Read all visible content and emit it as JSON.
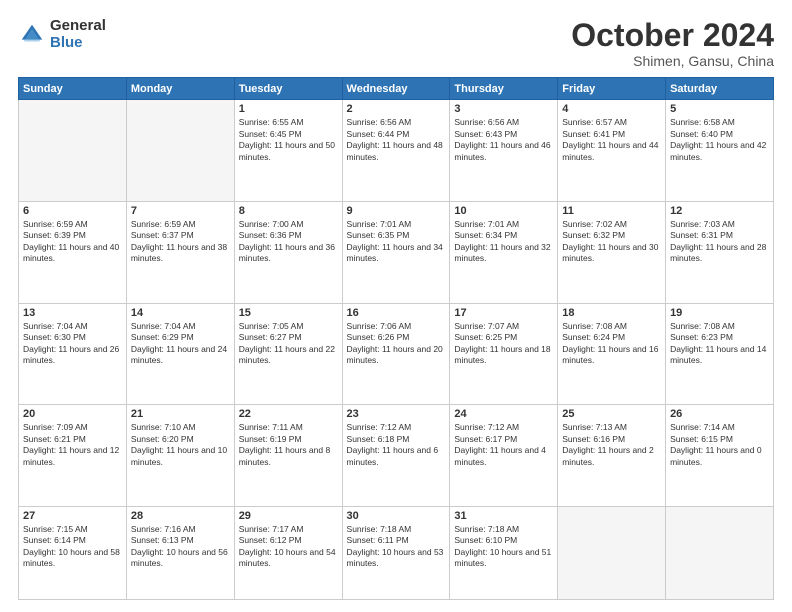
{
  "logo": {
    "general": "General",
    "blue": "Blue"
  },
  "header": {
    "month": "October 2024",
    "location": "Shimen, Gansu, China"
  },
  "weekdays": [
    "Sunday",
    "Monday",
    "Tuesday",
    "Wednesday",
    "Thursday",
    "Friday",
    "Saturday"
  ],
  "weeks": [
    [
      {
        "day": "",
        "sunrise": "",
        "sunset": "",
        "daylight": "",
        "empty": true
      },
      {
        "day": "",
        "sunrise": "",
        "sunset": "",
        "daylight": "",
        "empty": true
      },
      {
        "day": "1",
        "sunrise": "Sunrise: 6:55 AM",
        "sunset": "Sunset: 6:45 PM",
        "daylight": "Daylight: 11 hours and 50 minutes.",
        "empty": false
      },
      {
        "day": "2",
        "sunrise": "Sunrise: 6:56 AM",
        "sunset": "Sunset: 6:44 PM",
        "daylight": "Daylight: 11 hours and 48 minutes.",
        "empty": false
      },
      {
        "day": "3",
        "sunrise": "Sunrise: 6:56 AM",
        "sunset": "Sunset: 6:43 PM",
        "daylight": "Daylight: 11 hours and 46 minutes.",
        "empty": false
      },
      {
        "day": "4",
        "sunrise": "Sunrise: 6:57 AM",
        "sunset": "Sunset: 6:41 PM",
        "daylight": "Daylight: 11 hours and 44 minutes.",
        "empty": false
      },
      {
        "day": "5",
        "sunrise": "Sunrise: 6:58 AM",
        "sunset": "Sunset: 6:40 PM",
        "daylight": "Daylight: 11 hours and 42 minutes.",
        "empty": false
      }
    ],
    [
      {
        "day": "6",
        "sunrise": "Sunrise: 6:59 AM",
        "sunset": "Sunset: 6:39 PM",
        "daylight": "Daylight: 11 hours and 40 minutes.",
        "empty": false
      },
      {
        "day": "7",
        "sunrise": "Sunrise: 6:59 AM",
        "sunset": "Sunset: 6:37 PM",
        "daylight": "Daylight: 11 hours and 38 minutes.",
        "empty": false
      },
      {
        "day": "8",
        "sunrise": "Sunrise: 7:00 AM",
        "sunset": "Sunset: 6:36 PM",
        "daylight": "Daylight: 11 hours and 36 minutes.",
        "empty": false
      },
      {
        "day": "9",
        "sunrise": "Sunrise: 7:01 AM",
        "sunset": "Sunset: 6:35 PM",
        "daylight": "Daylight: 11 hours and 34 minutes.",
        "empty": false
      },
      {
        "day": "10",
        "sunrise": "Sunrise: 7:01 AM",
        "sunset": "Sunset: 6:34 PM",
        "daylight": "Daylight: 11 hours and 32 minutes.",
        "empty": false
      },
      {
        "day": "11",
        "sunrise": "Sunrise: 7:02 AM",
        "sunset": "Sunset: 6:32 PM",
        "daylight": "Daylight: 11 hours and 30 minutes.",
        "empty": false
      },
      {
        "day": "12",
        "sunrise": "Sunrise: 7:03 AM",
        "sunset": "Sunset: 6:31 PM",
        "daylight": "Daylight: 11 hours and 28 minutes.",
        "empty": false
      }
    ],
    [
      {
        "day": "13",
        "sunrise": "Sunrise: 7:04 AM",
        "sunset": "Sunset: 6:30 PM",
        "daylight": "Daylight: 11 hours and 26 minutes.",
        "empty": false
      },
      {
        "day": "14",
        "sunrise": "Sunrise: 7:04 AM",
        "sunset": "Sunset: 6:29 PM",
        "daylight": "Daylight: 11 hours and 24 minutes.",
        "empty": false
      },
      {
        "day": "15",
        "sunrise": "Sunrise: 7:05 AM",
        "sunset": "Sunset: 6:27 PM",
        "daylight": "Daylight: 11 hours and 22 minutes.",
        "empty": false
      },
      {
        "day": "16",
        "sunrise": "Sunrise: 7:06 AM",
        "sunset": "Sunset: 6:26 PM",
        "daylight": "Daylight: 11 hours and 20 minutes.",
        "empty": false
      },
      {
        "day": "17",
        "sunrise": "Sunrise: 7:07 AM",
        "sunset": "Sunset: 6:25 PM",
        "daylight": "Daylight: 11 hours and 18 minutes.",
        "empty": false
      },
      {
        "day": "18",
        "sunrise": "Sunrise: 7:08 AM",
        "sunset": "Sunset: 6:24 PM",
        "daylight": "Daylight: 11 hours and 16 minutes.",
        "empty": false
      },
      {
        "day": "19",
        "sunrise": "Sunrise: 7:08 AM",
        "sunset": "Sunset: 6:23 PM",
        "daylight": "Daylight: 11 hours and 14 minutes.",
        "empty": false
      }
    ],
    [
      {
        "day": "20",
        "sunrise": "Sunrise: 7:09 AM",
        "sunset": "Sunset: 6:21 PM",
        "daylight": "Daylight: 11 hours and 12 minutes.",
        "empty": false
      },
      {
        "day": "21",
        "sunrise": "Sunrise: 7:10 AM",
        "sunset": "Sunset: 6:20 PM",
        "daylight": "Daylight: 11 hours and 10 minutes.",
        "empty": false
      },
      {
        "day": "22",
        "sunrise": "Sunrise: 7:11 AM",
        "sunset": "Sunset: 6:19 PM",
        "daylight": "Daylight: 11 hours and 8 minutes.",
        "empty": false
      },
      {
        "day": "23",
        "sunrise": "Sunrise: 7:12 AM",
        "sunset": "Sunset: 6:18 PM",
        "daylight": "Daylight: 11 hours and 6 minutes.",
        "empty": false
      },
      {
        "day": "24",
        "sunrise": "Sunrise: 7:12 AM",
        "sunset": "Sunset: 6:17 PM",
        "daylight": "Daylight: 11 hours and 4 minutes.",
        "empty": false
      },
      {
        "day": "25",
        "sunrise": "Sunrise: 7:13 AM",
        "sunset": "Sunset: 6:16 PM",
        "daylight": "Daylight: 11 hours and 2 minutes.",
        "empty": false
      },
      {
        "day": "26",
        "sunrise": "Sunrise: 7:14 AM",
        "sunset": "Sunset: 6:15 PM",
        "daylight": "Daylight: 11 hours and 0 minutes.",
        "empty": false
      }
    ],
    [
      {
        "day": "27",
        "sunrise": "Sunrise: 7:15 AM",
        "sunset": "Sunset: 6:14 PM",
        "daylight": "Daylight: 10 hours and 58 minutes.",
        "empty": false
      },
      {
        "day": "28",
        "sunrise": "Sunrise: 7:16 AM",
        "sunset": "Sunset: 6:13 PM",
        "daylight": "Daylight: 10 hours and 56 minutes.",
        "empty": false
      },
      {
        "day": "29",
        "sunrise": "Sunrise: 7:17 AM",
        "sunset": "Sunset: 6:12 PM",
        "daylight": "Daylight: 10 hours and 54 minutes.",
        "empty": false
      },
      {
        "day": "30",
        "sunrise": "Sunrise: 7:18 AM",
        "sunset": "Sunset: 6:11 PM",
        "daylight": "Daylight: 10 hours and 53 minutes.",
        "empty": false
      },
      {
        "day": "31",
        "sunrise": "Sunrise: 7:18 AM",
        "sunset": "Sunset: 6:10 PM",
        "daylight": "Daylight: 10 hours and 51 minutes.",
        "empty": false
      },
      {
        "day": "",
        "sunrise": "",
        "sunset": "",
        "daylight": "",
        "empty": true
      },
      {
        "day": "",
        "sunrise": "",
        "sunset": "",
        "daylight": "",
        "empty": true
      }
    ]
  ]
}
